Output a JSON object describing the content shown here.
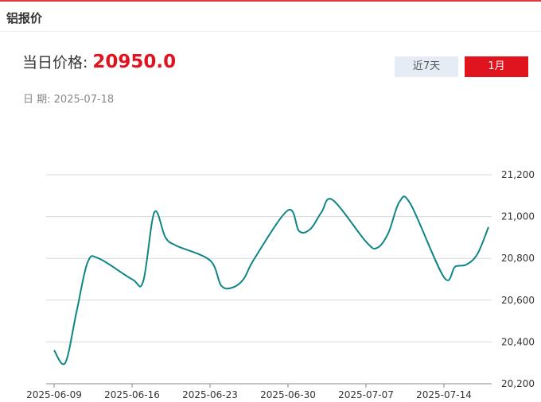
{
  "header": {
    "title": "铝报价"
  },
  "price": {
    "label": "当日价格:",
    "value": "20950.0"
  },
  "date": {
    "label": "日 期:",
    "value": "2025-07-18"
  },
  "tabs": [
    {
      "label": "近7天",
      "active": false
    },
    {
      "label": "1月",
      "active": true
    }
  ],
  "colors": {
    "accent": "#e0141e",
    "line": "#0f8584",
    "grid": "#d9d9d9",
    "tab_inactive": "#e6ecf5"
  },
  "chart_data": {
    "type": "line",
    "title": "",
    "xlabel": "",
    "ylabel": "",
    "ylim": [
      20200,
      21200
    ],
    "y_ticks": [
      "20,200",
      "20,400",
      "20,600",
      "20,800",
      "21,000",
      "21,200"
    ],
    "x_tick_labels": [
      "2025-06-09",
      "2025-06-16",
      "2025-06-23",
      "2025-06-30",
      "2025-07-07",
      "2025-07-14"
    ],
    "grid": true,
    "series": [
      {
        "x": [
          "2025-06-09",
          "2025-06-10",
          "2025-06-11",
          "2025-06-12",
          "2025-06-13",
          "2025-06-16",
          "2025-06-17",
          "2025-06-18",
          "2025-06-19",
          "2025-06-20",
          "2025-06-23",
          "2025-06-24",
          "2025-06-25",
          "2025-06-26",
          "2025-06-27",
          "2025-06-30",
          "2025-07-01",
          "2025-07-02",
          "2025-07-03",
          "2025-07-04",
          "2025-07-07",
          "2025-07-08",
          "2025-07-09",
          "2025-07-10",
          "2025-07-11",
          "2025-07-14",
          "2025-07-15",
          "2025-07-16",
          "2025-07-17",
          "2025-07-18"
        ],
        "values": [
          20360,
          20300,
          20540,
          20780,
          20800,
          20700,
          20690,
          21020,
          20900,
          20860,
          20790,
          20670,
          20660,
          20700,
          20800,
          21030,
          20930,
          20940,
          21020,
          21080,
          20880,
          20850,
          20920,
          21070,
          21060,
          20710,
          20760,
          20770,
          20820,
          20950
        ]
      }
    ]
  }
}
